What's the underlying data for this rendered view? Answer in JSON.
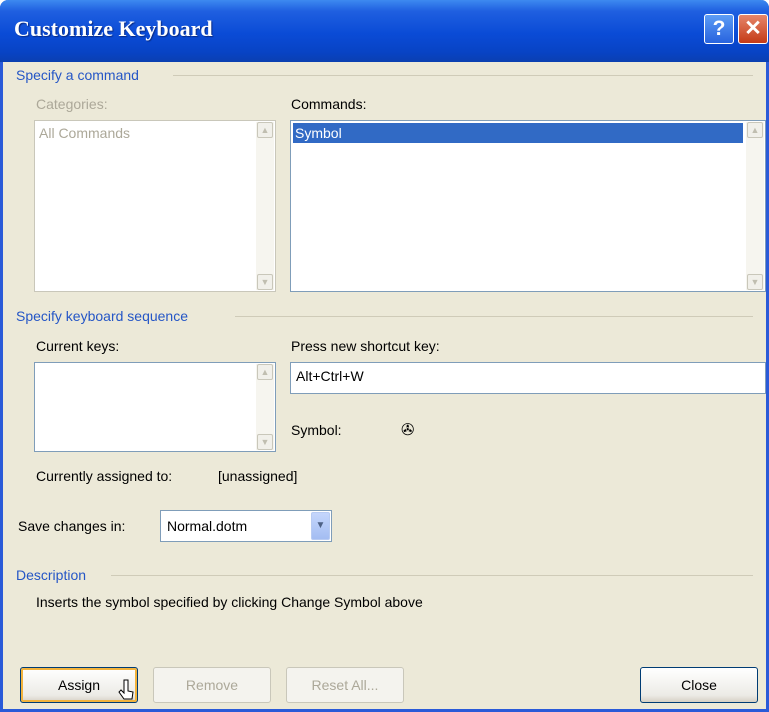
{
  "window": {
    "title": "Customize Keyboard"
  },
  "title_buttons": {
    "help": "?",
    "close": "✕"
  },
  "specify_command": {
    "group_label": "Specify a command",
    "categories_label": "Categories:",
    "categories": [
      "All Commands"
    ],
    "commands_label": "Commands:",
    "commands": [
      "Symbol"
    ]
  },
  "keyboard_sequence": {
    "group_label": "Specify keyboard sequence",
    "current_keys_label": "Current keys:",
    "new_shortcut_label": "Press new shortcut key:",
    "new_shortcut_value": "Alt+Ctrl+W",
    "symbol_label": "Symbol:",
    "symbol_glyph": "✇",
    "assigned_label": "Currently assigned to:",
    "assigned_value": "[unassigned]"
  },
  "save_changes": {
    "label": "Save changes in:",
    "value": "Normal.dotm"
  },
  "description": {
    "group_label": "Description",
    "text": "Inserts the symbol specified by clicking Change Symbol above"
  },
  "buttons": {
    "assign": "Assign",
    "remove": "Remove",
    "reset_all": "Reset All...",
    "close": "Close"
  },
  "colors": {
    "title_bar": "#0a4bd6",
    "selection": "#316ac5",
    "group_label": "#2556c6",
    "dialog_bg": "#ece9d8"
  }
}
